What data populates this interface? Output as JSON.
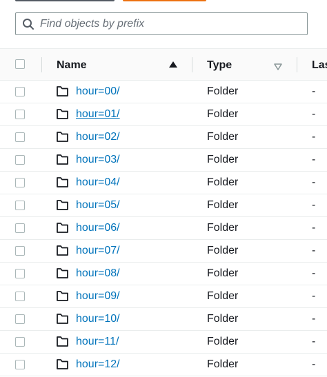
{
  "search": {
    "placeholder": "Find objects by prefix"
  },
  "table": {
    "columns": {
      "name": "Name",
      "type": "Type",
      "last_modified": "Las"
    },
    "sort": {
      "name": "ascending",
      "type": "unsorted"
    },
    "rows": [
      {
        "name": "hour=00/",
        "type": "Folder",
        "last_modified": "-"
      },
      {
        "name": "hour=01/",
        "type": "Folder",
        "last_modified": "-"
      },
      {
        "name": "hour=02/",
        "type": "Folder",
        "last_modified": "-"
      },
      {
        "name": "hour=03/",
        "type": "Folder",
        "last_modified": "-"
      },
      {
        "name": "hour=04/",
        "type": "Folder",
        "last_modified": "-"
      },
      {
        "name": "hour=05/",
        "type": "Folder",
        "last_modified": "-"
      },
      {
        "name": "hour=06/",
        "type": "Folder",
        "last_modified": "-"
      },
      {
        "name": "hour=07/",
        "type": "Folder",
        "last_modified": "-"
      },
      {
        "name": "hour=08/",
        "type": "Folder",
        "last_modified": "-"
      },
      {
        "name": "hour=09/",
        "type": "Folder",
        "last_modified": "-"
      },
      {
        "name": "hour=10/",
        "type": "Folder",
        "last_modified": "-"
      },
      {
        "name": "hour=11/",
        "type": "Folder",
        "last_modified": "-"
      },
      {
        "name": "hour=12/",
        "type": "Folder",
        "last_modified": "-"
      }
    ],
    "hovered_row": "hour=01/"
  },
  "colors": {
    "link": "#0073bb",
    "text": "#16191f",
    "primary_button": "#ec7211",
    "secondary_button": "#545b64",
    "border": "#eaeded"
  },
  "icons": {
    "search": "search-icon",
    "folder": "folder-icon",
    "sort_ascending": "sort-ascending-icon",
    "sort_descending": "sort-descending-icon"
  }
}
